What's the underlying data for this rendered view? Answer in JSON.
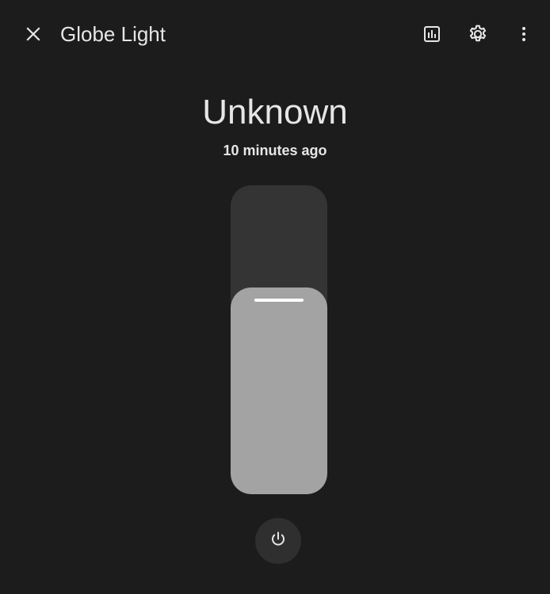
{
  "header": {
    "title": "Globe Light",
    "close_icon": "close-icon",
    "history_icon": "chart-box-icon",
    "settings_icon": "gear-icon",
    "more_icon": "dots-vertical-icon"
  },
  "state": {
    "value": "Unknown",
    "last_changed": "10 minutes ago"
  },
  "brightness_slider": {
    "level_percent": 67
  },
  "power": {
    "icon": "power-icon"
  },
  "colors": {
    "background": "#1c1c1c",
    "slider_track": "#343434",
    "slider_fill": "#a3a3a3",
    "text": "#e6e6e6"
  }
}
